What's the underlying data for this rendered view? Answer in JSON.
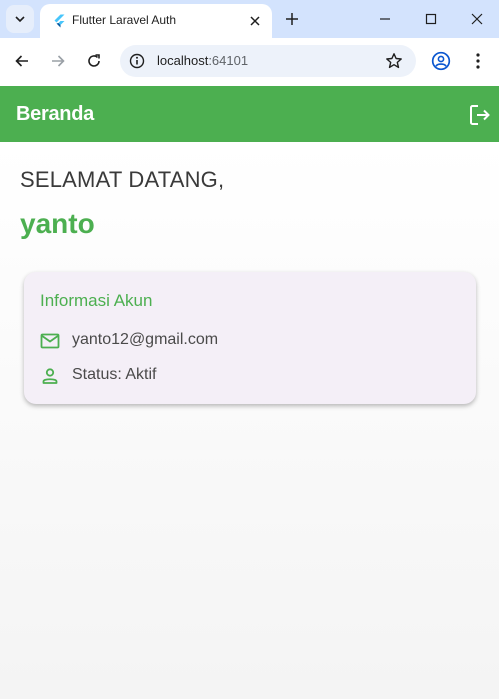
{
  "browser": {
    "tab_title": "Flutter Laravel Auth",
    "url_host": "localhost",
    "url_port": ":64101"
  },
  "app": {
    "appbar_title": "Beranda",
    "welcome_text": "SELAMAT DATANG,",
    "username": "yanto",
    "card": {
      "title": "Informasi Akun",
      "email": "yanto12@gmail.com",
      "status": "Status: Aktif"
    }
  },
  "colors": {
    "primary": "#4caf50",
    "card_background": "#f4eff7",
    "tabstrip": "#d3e3fd"
  }
}
